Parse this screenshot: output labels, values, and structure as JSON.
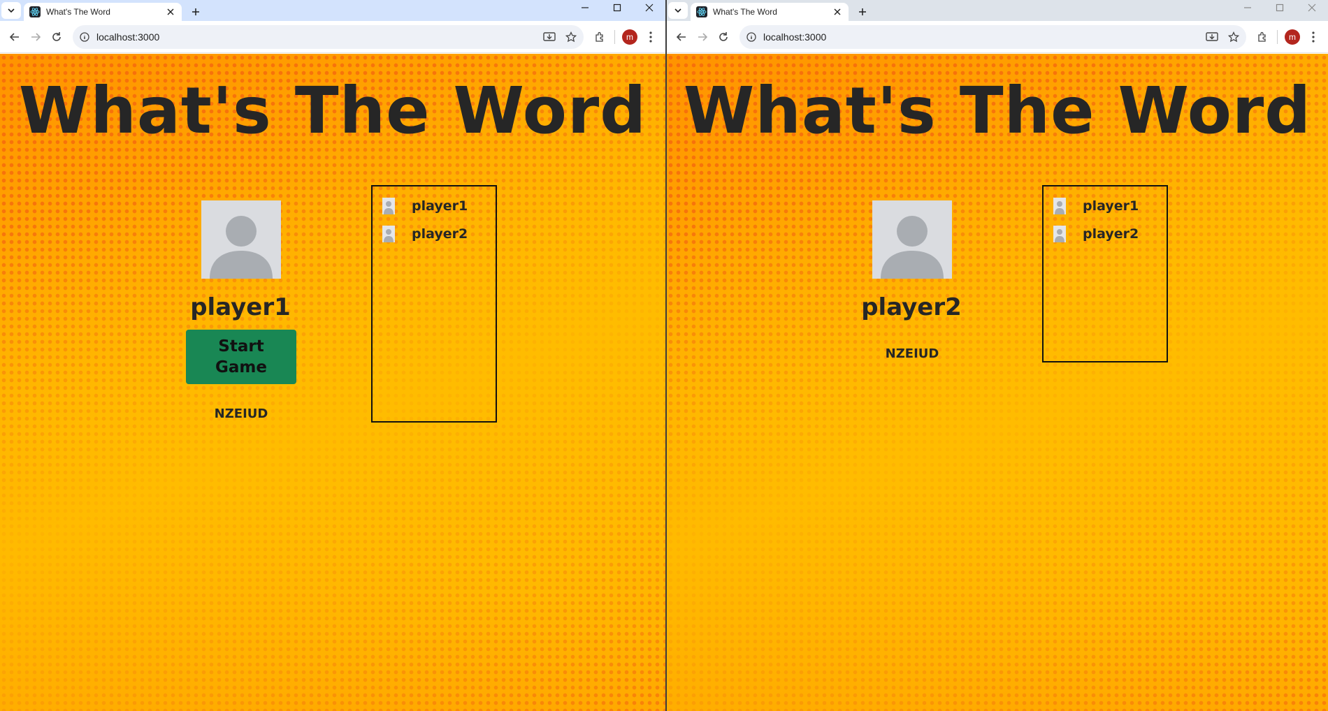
{
  "browser": {
    "tab_title": "What's The Word",
    "url": "localhost:3000",
    "profile_initial": "m"
  },
  "windows": {
    "left": {
      "title": "What's The Word",
      "current_player": "player1",
      "start_button_label": "Start Game",
      "room_code": "NZEIUD",
      "player_list": [
        "player1",
        "player2"
      ]
    },
    "right": {
      "title": "What's The Word",
      "current_player": "player2",
      "room_code": "NZEIUD",
      "player_list": [
        "player1",
        "player2"
      ]
    }
  },
  "colors": {
    "page_background": "#ffb400",
    "start_button": "#198754",
    "title_text": "#262626"
  },
  "icons": [
    "chevron-down-icon",
    "react-favicon-icon",
    "close-icon",
    "plus-icon",
    "minimize-icon",
    "maximize-icon",
    "back-icon",
    "forward-icon",
    "reload-icon",
    "site-info-icon",
    "install-app-icon",
    "star-icon",
    "extensions-icon",
    "more-vert-icon",
    "default-avatar-icon"
  ]
}
